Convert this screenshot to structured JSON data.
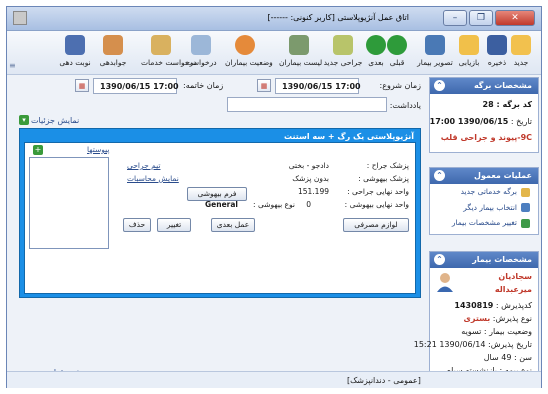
{
  "window": {
    "title": "اتاق عمل آنژیوپلاستی [کاربر کنونی: ------]",
    "buttons": [
      "–",
      "❐",
      "✕"
    ]
  },
  "toolbar": {
    "items": [
      {
        "label": "جدید",
        "icon": "new-doc-icon",
        "color": "#f2c14e"
      },
      {
        "label": "ذخیره",
        "icon": "save-icon",
        "color": "#3c5fa0"
      },
      {
        "label": "بازیابی",
        "icon": "folder-icon",
        "color": "#f1c04a"
      },
      {
        "label": "تصویر بیمار",
        "icon": "image-icon",
        "color": "#4a79b5"
      },
      {
        "label": "قبلی",
        "icon": "prev-icon",
        "color": "#2e9b3a"
      },
      {
        "label": "بعدی",
        "icon": "next-icon",
        "color": "#2e9b3a"
      },
      {
        "label": "جراحی جدید",
        "icon": "surgery-icon",
        "color": "#b8c46a"
      },
      {
        "label": "لیست بیماران",
        "icon": "search-icon",
        "color": "#7c9a6d"
      },
      {
        "label": "وضعیت بیماران",
        "icon": "patient-status-icon",
        "color": "#e58a3a"
      },
      {
        "label": "درخواست",
        "icon": "request-icon",
        "color": "#9cb7d8"
      },
      {
        "label": "درخواست خدمات",
        "icon": "service-request-icon",
        "color": "#d9b15f"
      },
      {
        "label": "جوابدهی",
        "icon": "answer-icon",
        "color": "#d58f4d"
      },
      {
        "label": "نوبت دهی",
        "icon": "appointment-icon",
        "color": "#4d6fb0"
      }
    ]
  },
  "main": {
    "start_label": "زمان شروع:",
    "start_value": "1390/06/15 17:00",
    "end_label": "زمان خاتمه:",
    "end_value": "1390/06/15 17:00",
    "note_label": "یادداشت:",
    "show_details": "نمایش جزئیات",
    "card": {
      "title": "آنژیوپلاستی یک رگ + سه استنت",
      "attachments": "پیوستها",
      "surgeon_label": "پزشک جراح :",
      "surgeon_value": "دادجو - بختی",
      "anesth_label": "پزشک بیهوشی :",
      "anesth_value": "بدون پزشک",
      "final_unit_label": "واحد نهایی جراحی :",
      "final_unit_value": "151.199",
      "anesth_unit_label": "واحد نهایی بیهوشی :",
      "anesth_unit_value": "0",
      "anesth_type_label": "نوع بیهوشی :",
      "anesth_type_value": "General",
      "team_link": "تیم جراحی",
      "calc_link": "نمایش محاسبات",
      "anesth_form": "فرم بیهوشی",
      "consumables": "لوازم مصرفی",
      "next_op": "عمل بعدی",
      "change": "تغییر",
      "delete": "حذف"
    },
    "amputation_form": "فرم قطع عضو"
  },
  "status": "[عمومی - دندانپزشک]",
  "sidebar": {
    "record": {
      "title": "مشخصات برگه",
      "number_label": "کد برگه :",
      "number_value": "28",
      "date_label": "تاریخ :",
      "date_value": "1390/06/15 17:00",
      "diagnosis": "9C-پیوند و جراحی قلب"
    },
    "ops": {
      "title": "عملیات معمول",
      "items": [
        {
          "label": "برگه خدماتی جدید",
          "icon": "new-sheet-icon",
          "color": "#e3b64a"
        },
        {
          "label": "انتخاب بیمار دیگر",
          "icon": "select-patient-icon",
          "color": "#4d7fc0"
        },
        {
          "label": "تغییر مشخصات بیمار",
          "icon": "edit-patient-icon",
          "color": "#3e9a48"
        }
      ]
    },
    "patient": {
      "title": "مشخصات بیمار",
      "first_name": "سجادیان",
      "last_name": "میرعبداله",
      "admission_label": "کدپذیرش :",
      "admission_value": "1430819",
      "type_label": "نوع پذیرش:",
      "type_value": "بستری",
      "state_label": "وضعیت بیمار :",
      "state_value": "تسویه",
      "adm_date_label": "تاریخ پذیرش:",
      "adm_date_value": "1390/06/14 15:21",
      "age_label": "سن :",
      "age_value": "49 سال",
      "insurance_label": "نوع بیمه :",
      "insurance_value": "بازنشسته سپاه"
    }
  }
}
